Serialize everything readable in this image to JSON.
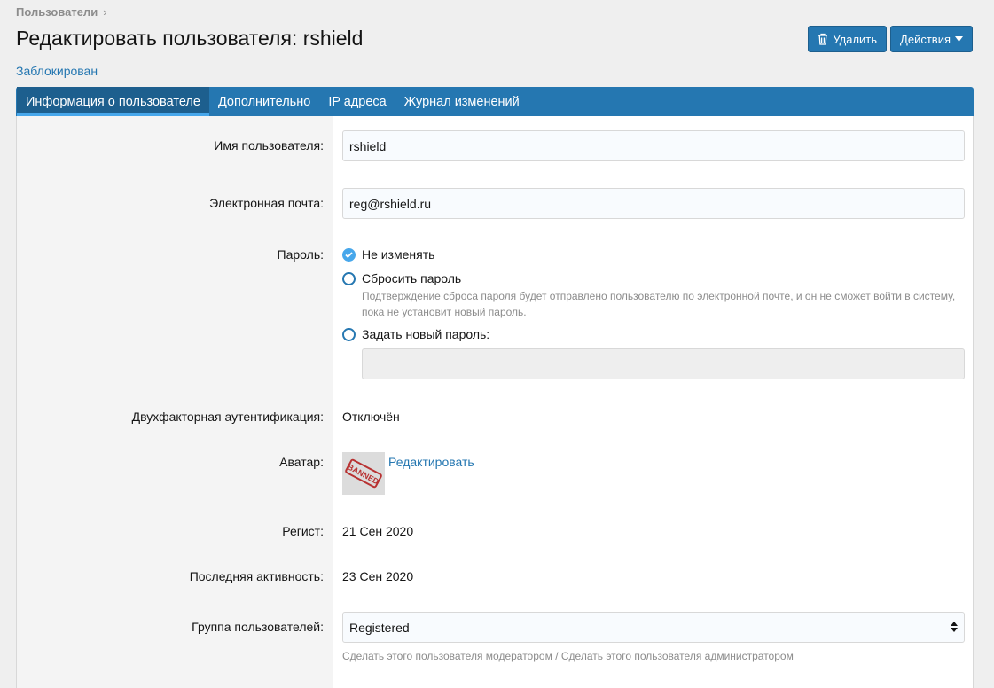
{
  "breadcrumb": {
    "parent": "Пользователи",
    "chevron": "›"
  },
  "page": {
    "title": "Редактировать пользователя: rshield",
    "status": "Заблокирован"
  },
  "actions": {
    "delete_label": "Удалить",
    "actions_label": "Действия"
  },
  "tabs": [
    {
      "label": "Информация о пользователе",
      "active": true
    },
    {
      "label": "Дополнительно",
      "active": false
    },
    {
      "label": "IP адреса",
      "active": false
    },
    {
      "label": "Журнал изменений",
      "active": false
    }
  ],
  "form": {
    "username": {
      "label": "Имя пользователя:",
      "value": "rshield"
    },
    "email": {
      "label": "Электронная почта:",
      "value": "reg@rshield.ru"
    },
    "password": {
      "label": "Пароль:",
      "options": [
        {
          "label": "Не изменять",
          "checked": true
        },
        {
          "label": "Сбросить пароль",
          "checked": false
        },
        {
          "label": "Задать новый пароль:",
          "checked": false
        }
      ],
      "reset_hint": "Подтверждение сброса пароля будет отправлено пользователю по электронной почте, и он не сможет войти в систему, пока не установит новый пароль.",
      "new_password_value": ""
    },
    "two_factor": {
      "label": "Двухфакторная аутентификация:",
      "value": "Отключён"
    },
    "avatar": {
      "label": "Аватар:",
      "edit_link": "Редактировать",
      "stamp_text": "BANNED"
    },
    "registered": {
      "label": "Регист:",
      "value": "21 Сен 2020"
    },
    "last_activity": {
      "label": "Последняя активность:",
      "value": "23 Сен 2020"
    },
    "user_group": {
      "label": "Группа пользователей:",
      "value": "Registered",
      "make_moderator": "Сделать этого пользователя модератором",
      "separator": "/",
      "make_admin": "Сделать этого пользователя администратором"
    }
  },
  "colors": {
    "accent": "#2577b1",
    "tab_active": "#1d5f8e",
    "radio_checked": "#47a7eb"
  }
}
